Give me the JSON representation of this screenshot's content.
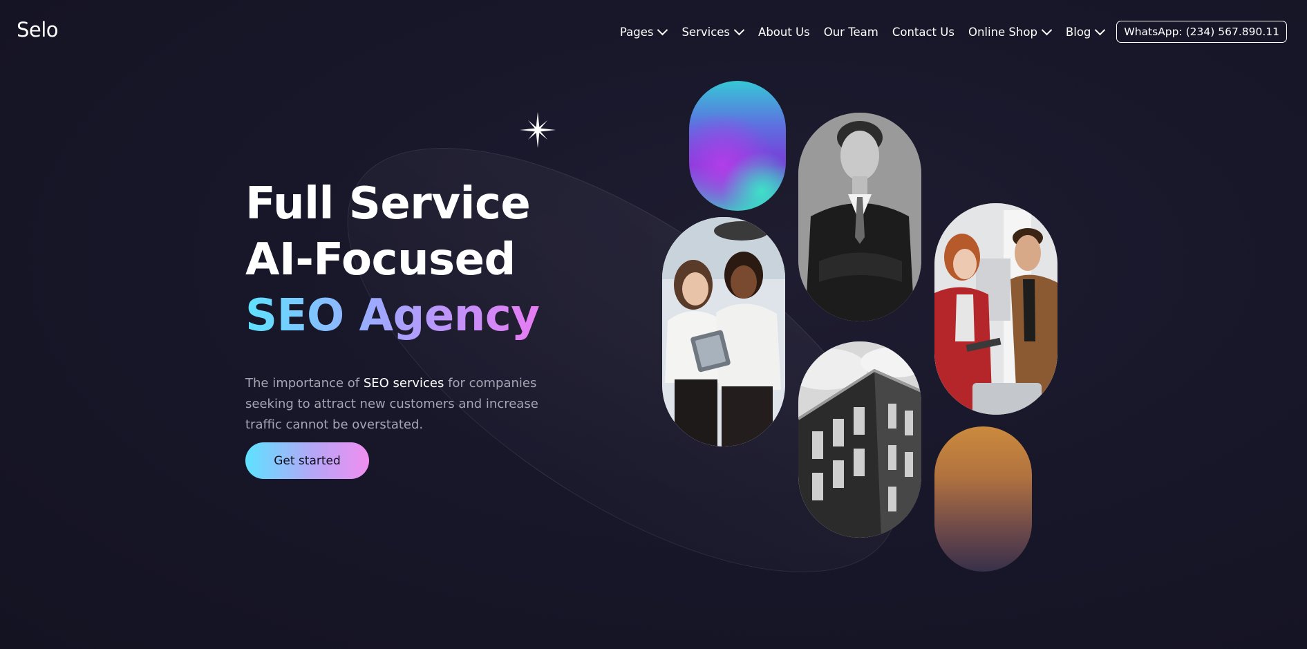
{
  "header": {
    "logo": "Selo",
    "nav": [
      {
        "label": "Pages",
        "has_dropdown": true
      },
      {
        "label": "Services",
        "has_dropdown": true
      },
      {
        "label": "About Us",
        "has_dropdown": false
      },
      {
        "label": "Our Team",
        "has_dropdown": false
      },
      {
        "label": "Contact Us",
        "has_dropdown": false
      },
      {
        "label": "Online Shop",
        "has_dropdown": true
      },
      {
        "label": "Blog",
        "has_dropdown": true
      }
    ],
    "whatsapp_button": "WhatsApp: (234) 567.890.11"
  },
  "hero": {
    "title_line_1": "Full Service",
    "title_line_2": "AI-Focused",
    "title_line_3": "SEO Agency",
    "description_prefix": "The importance of ",
    "description_highlight": "SEO services",
    "description_suffix": " for companies seeking to attract new customers and increase traffic cannot be overstated.",
    "cta_label": "Get started"
  },
  "colors": {
    "background": "#18172a",
    "gradient_start": "#5ee2ff",
    "gradient_mid": "#9fa8ff",
    "gradient_end": "#e77bf2",
    "muted_text": "#a6a5b3"
  },
  "gallery": {
    "images": [
      "gradient-blob-image",
      "two-women-with-tablet-photo",
      "businessman-portrait-photo",
      "office-building-photo",
      "colleagues-at-laptop-photo",
      "orange-gradient-image"
    ]
  },
  "icons": {
    "sparkle": "sparkle-star-icon",
    "dropdown": "chevron-down-icon"
  }
}
